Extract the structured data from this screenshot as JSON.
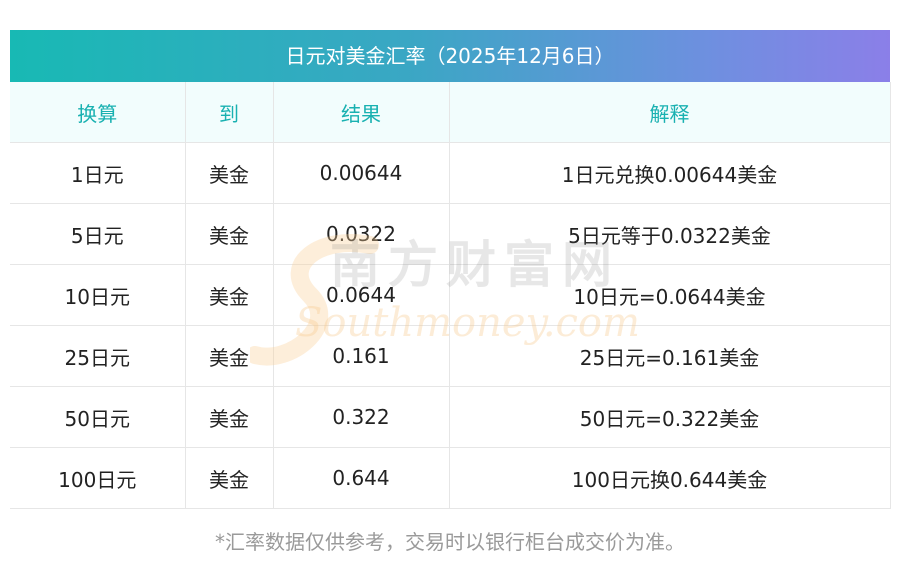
{
  "title": "日元对美金汇率（2025年12月6日）",
  "headers": [
    "换算",
    "到",
    "结果",
    "解释"
  ],
  "rows": [
    {
      "amount": "1日元",
      "to": "美金",
      "result": "0.00644",
      "explain": "1日元兑换0.00644美金"
    },
    {
      "amount": "5日元",
      "to": "美金",
      "result": "0.0322",
      "explain": "5日元等于0.0322美金"
    },
    {
      "amount": "10日元",
      "to": "美金",
      "result": "0.0644",
      "explain": "10日元=0.0644美金"
    },
    {
      "amount": "25日元",
      "to": "美金",
      "result": "0.161",
      "explain": "25日元=0.161美金"
    },
    {
      "amount": "50日元",
      "to": "美金",
      "result": "0.322",
      "explain": "50日元=0.322美金"
    },
    {
      "amount": "100日元",
      "to": "美金",
      "result": "0.644",
      "explain": "100日元换0.644美金"
    }
  ],
  "footnote": "*汇率数据仅供参考，交易时以银行柜台成交价为准。",
  "watermark": {
    "cn": "南方财富网",
    "en": "Southmoney.com"
  },
  "colors": {
    "header_text": "#19b1b1",
    "header_bg": "#f2fdfd",
    "title_gradient_start": "#18b9b4",
    "title_gradient_end": "#8b7fe8"
  }
}
